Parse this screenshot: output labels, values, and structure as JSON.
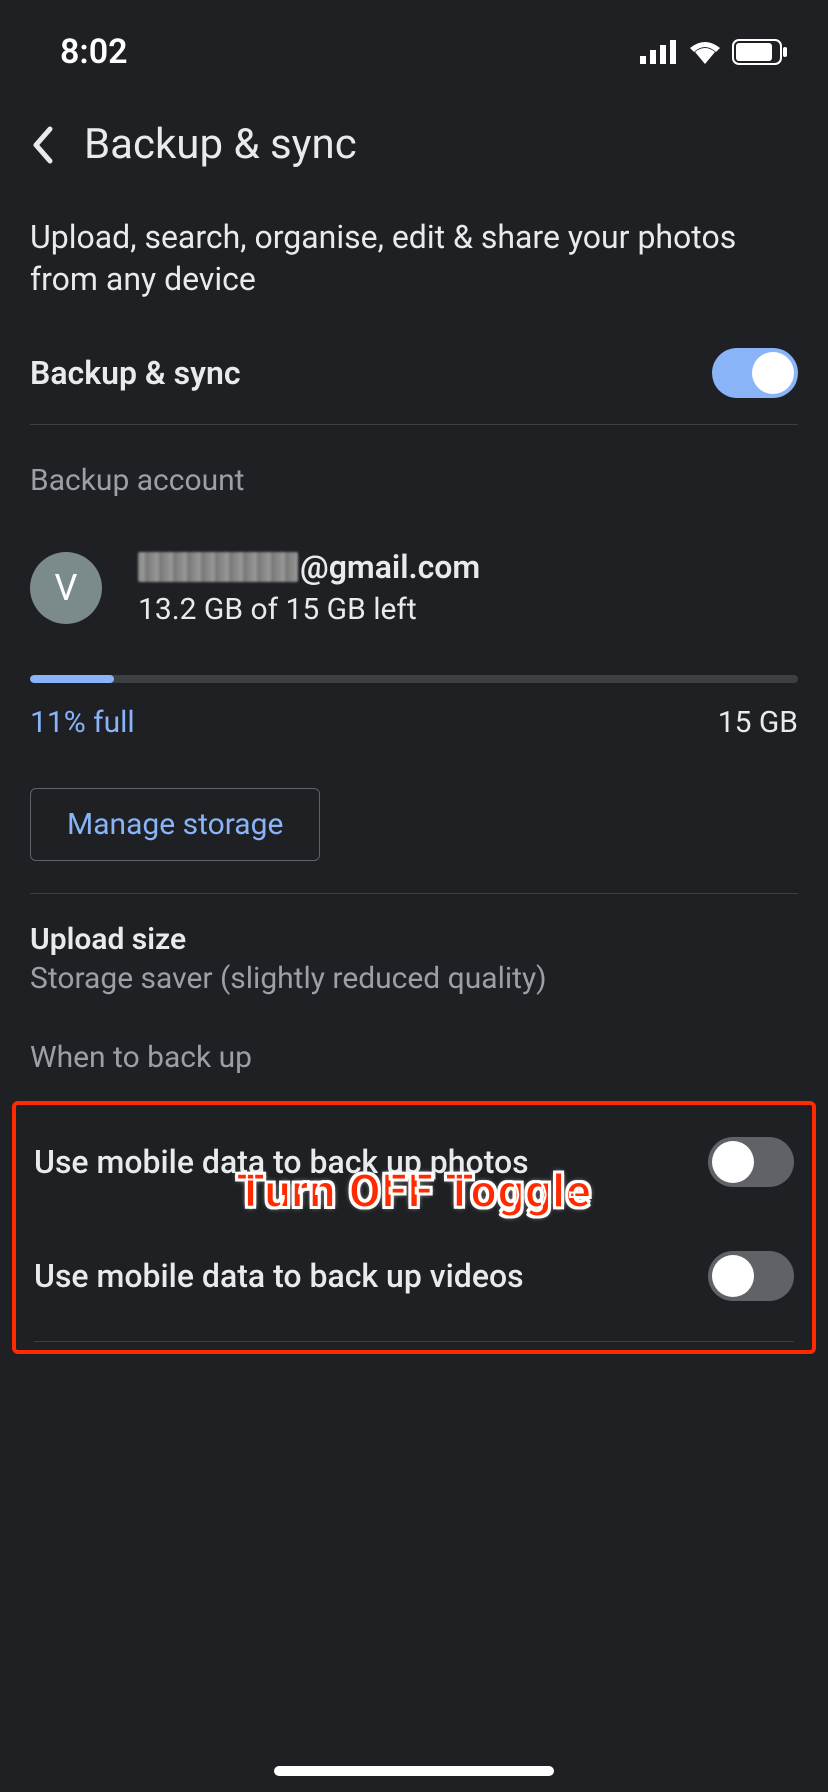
{
  "status": {
    "time": "8:02"
  },
  "header": {
    "title": "Backup & sync"
  },
  "description": "Upload, search, organise, edit & share your photos from any device",
  "backup_sync": {
    "label": "Backup & sync"
  },
  "section_account": "Backup account",
  "account": {
    "avatar_initial": "V",
    "email_suffix": "@gmail.com",
    "storage_text": "13.2 GB of 15 GB left"
  },
  "storage": {
    "percent_full": "11% full",
    "total": "15 GB",
    "manage_label": "Manage storage",
    "fill_percent": 11
  },
  "upload_size": {
    "title": "Upload size",
    "subtitle": "Storage saver (slightly reduced quality)"
  },
  "section_when": "When to back up",
  "mobile_photos": {
    "label": "Use mobile data to back up photos"
  },
  "mobile_videos": {
    "label": "Use mobile data to back up videos"
  },
  "annotation": "Turn OFF Toggle"
}
